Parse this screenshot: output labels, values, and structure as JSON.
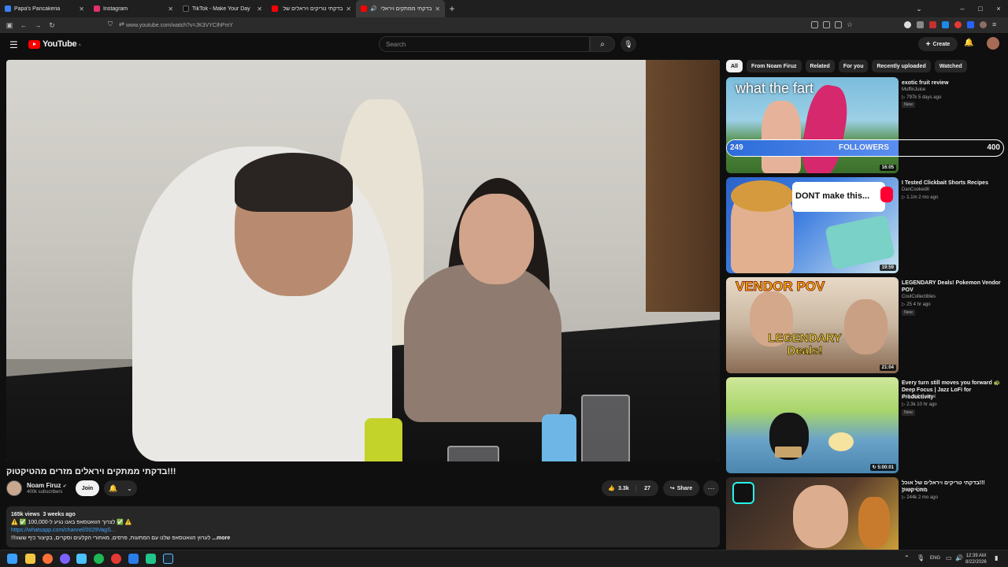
{
  "browser": {
    "tabs": [
      {
        "title": "Papa's Pancakeria",
        "favicon_color": "#3b82f6",
        "active": false
      },
      {
        "title": "Instagram",
        "favicon_color": "#e1306c",
        "active": false
      },
      {
        "title": "TikTok - Make Your Day",
        "favicon_color": "#111111",
        "active": false
      },
      {
        "title": "בדקתי טריקים ויראלים של אוכל",
        "favicon_color": "#ff0000",
        "active": false
      },
      {
        "title": "בדקתי ממתקים ויראלים מהטי",
        "favicon_color": "#ff0000",
        "active": true
      }
    ],
    "new_tab": "+",
    "url": "www.youtube.com/watch?v=JK3VYCIhPmY",
    "window_controls": {
      "minimize": "–",
      "maximize": "□",
      "close": "×"
    }
  },
  "youtube": {
    "logo_text": "YouTube",
    "logo_sup": "IL",
    "search_placeholder": "Search",
    "create_label": "Create",
    "video": {
      "title": "!!!בדקתי ממתקים ויראלים מזרים מהטיקטוק",
      "channel": "Noam Firuz",
      "subscribers": "400k subscribers",
      "join_label": "Join",
      "likes": "3.3k",
      "dislike_count": "27",
      "share_label": "Share",
      "description": {
        "views": "165k views",
        "age": "3 weeks ago",
        "line1": "⚠️ ✅ לצרוך הוואטסאפ באנו נגיע ל-100,000 ✅ ⚠️",
        "link": "https://whatsapp.com/channel/0029VagS...",
        "line3": "!!!לערוץ הוואטסאפ שלנו עם המתעות, פרסים, מאחורי הקלעים וסקרים, בקיצור כיף ששוו",
        "more": "...more"
      }
    },
    "chips": [
      "All",
      "From Noam Firuz",
      "Related",
      "For you",
      "Recently uploaded",
      "Watched"
    ],
    "recommendations": [
      {
        "title": "exotic fruit review",
        "channel": "MuffinJuice",
        "meta": "797k  5 days ago",
        "badge": "New",
        "duration": "16:05",
        "thumb_text": "what the fart",
        "thumb_colors": [
          "#7bbcdc",
          "#4e8a3a"
        ]
      },
      {
        "title": "I Tested Clickbait Shorts Recipes",
        "channel": "DanCookedIt",
        "meta": "1.1m  2 mo ago",
        "badge": "",
        "duration": "19:59",
        "thumb_text": "DONT make this...",
        "thumb_colors": [
          "#2c63c9",
          "#c7e3ef"
        ]
      },
      {
        "title": "LEGENDARY Deals! Pokemon Vendor POV",
        "channel": "CoulCollectibles",
        "meta": "25  4 hr ago",
        "badge": "New",
        "duration": "21:04",
        "thumb_text": "VENDOR POV",
        "thumb_text2": "LEGENDARY Deals!",
        "thumb_colors": [
          "#b63b2b",
          "#3a8ad0"
        ]
      },
      {
        "title": "Every turn still moves you forward 🐢 Deep Focus | Jazz LoFi for Productivity",
        "channel": "chill chilli journal",
        "meta": "2.3k  10 hr ago",
        "badge": "New",
        "duration": "5:00:01",
        "thumb_text": "",
        "thumb_colors": [
          "#a8d56b",
          "#6aa3c8"
        ]
      },
      {
        "title": "!!!בדקתי טריקים ויראלים של אוכל מהטיקטוק",
        "channel": "Noam Firuz",
        "meta": "244k  2 mo ago",
        "badge": "",
        "duration": "",
        "thumb_text": "",
        "thumb_colors": [
          "#3b2f2a",
          "#e3b23c"
        ]
      }
    ],
    "followers_overlay": {
      "current": "249",
      "label": "FOLLOWERS",
      "goal": "400",
      "progress": 0.62
    }
  },
  "taskbar": {
    "language": "ENG",
    "time": "12:39 AM",
    "date": "8/22/2026"
  }
}
